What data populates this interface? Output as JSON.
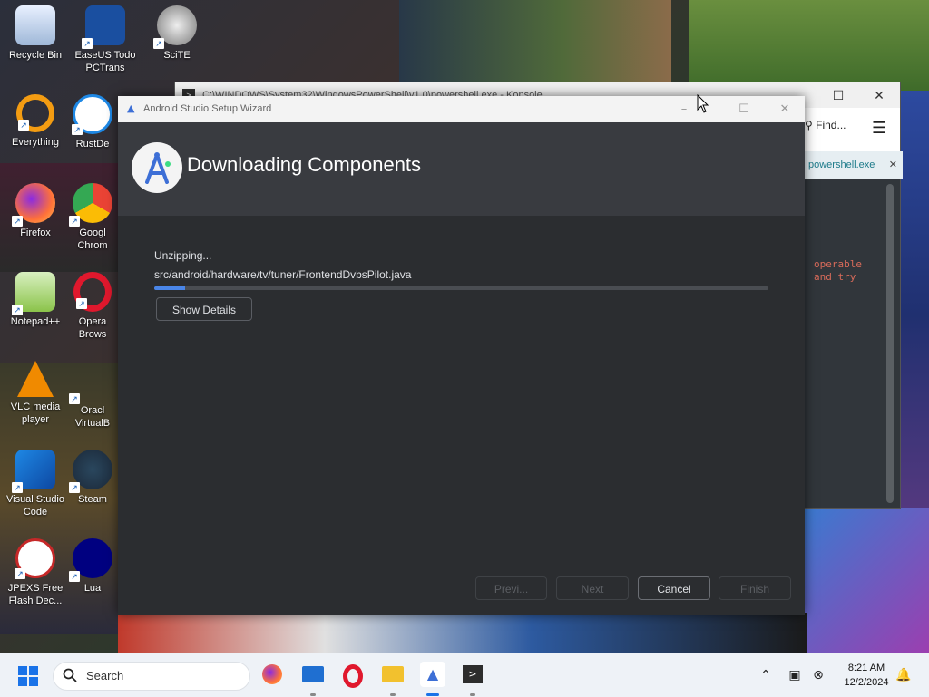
{
  "desktop": {
    "icons": [
      {
        "label": "Recycle Bin"
      },
      {
        "label": "EaseUS Todo PCTrans"
      },
      {
        "label": "SciTE"
      },
      {
        "label": "Everything"
      },
      {
        "label": "RustDe"
      },
      {
        "label": "Firefox"
      },
      {
        "label": "Googl Chrom"
      },
      {
        "label": "Notepad++"
      },
      {
        "label": "Opera Brows"
      },
      {
        "label": "VLC media player"
      },
      {
        "label": "Oracl VirtualB"
      },
      {
        "label": "Visual Studio Code"
      },
      {
        "label": "Steam"
      },
      {
        "label": "JPEXS Free Flash Dec..."
      },
      {
        "label": "Lua"
      }
    ]
  },
  "konsole": {
    "title": "C:\\WINDOWS\\System32\\WindowsPowerShell\\v1.0\\powershell.exe - Konsole",
    "find_label": "Find...",
    "tab_label": "powershell.exe",
    "output_lines": [
      "operable",
      "and try"
    ]
  },
  "wizard": {
    "title": "Android Studio Setup Wizard",
    "heading": "Downloading Components",
    "status": "Unzipping...",
    "file": "src/android/hardware/tv/tuner/FrontendDvbsPilot.java",
    "progress": 0.05,
    "show_details": "Show Details",
    "buttons": {
      "prev": "Previ...",
      "next": "Next",
      "cancel": "Cancel",
      "finish": "Finish"
    },
    "accent": "#4a86e8"
  },
  "taskbar": {
    "search_label": "Search",
    "time": "8:21 AM",
    "date": "12/2/2024"
  }
}
